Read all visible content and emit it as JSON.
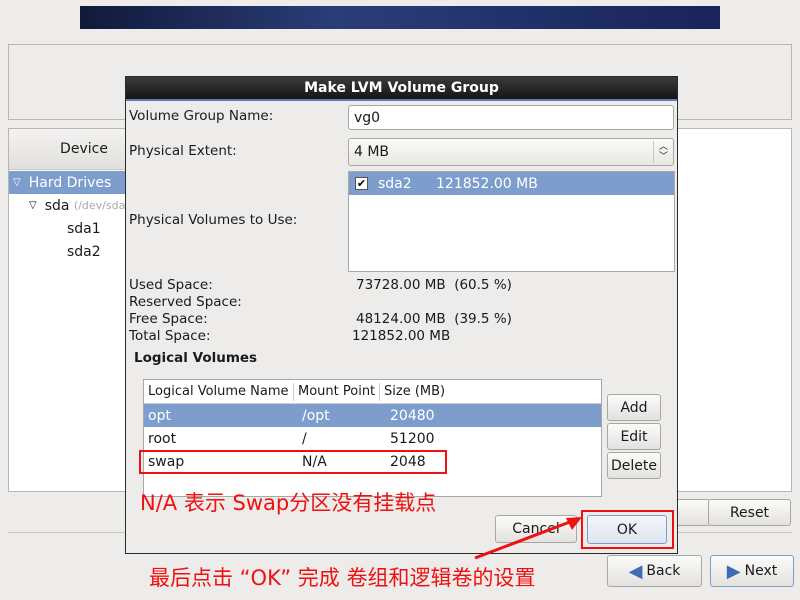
{
  "background": {
    "device_column": "Device",
    "tree": [
      {
        "label": "Hard Drives"
      },
      {
        "label": "sda",
        "path": "(/dev/sda"
      },
      {
        "label": "sda1"
      },
      {
        "label": "sda2"
      }
    ],
    "reset_label": "Reset",
    "back_label": "Back",
    "next_label": "Next"
  },
  "dialog": {
    "title": "Make LVM Volume Group",
    "vg_name_label": "Volume Group Name:",
    "vg_name_value": "vg0",
    "pe_label": "Physical Extent:",
    "pe_value": "4 MB",
    "pv_label": "Physical Volumes to Use:",
    "pv_items": [
      {
        "name": "sda2",
        "size": "121852.00 MB",
        "checked": true
      }
    ],
    "used_label": "Used Space:",
    "used_value": "73728.00 MB  (60.5 %)",
    "reserved_label": "Reserved Space:",
    "free_label": "Free Space:",
    "free_value": "48124.00 MB  (39.5 %)",
    "total_label": "Total Space:",
    "total_value": "121852.00 MB",
    "lv_heading": "Logical Volumes",
    "lv_columns": [
      "Logical Volume Name",
      "Mount Point",
      "Size (MB)"
    ],
    "lv_rows": [
      {
        "name": "opt",
        "mount": "/opt",
        "size": "20480"
      },
      {
        "name": "root",
        "mount": "/",
        "size": "51200"
      },
      {
        "name": "swap",
        "mount": "N/A",
        "size": "2048"
      }
    ],
    "add_label": "Add",
    "edit_label": "Edit",
    "delete_label": "Delete",
    "cancel_label": "Cancel",
    "ok_label": "OK"
  },
  "annotations": {
    "na_note": "N/A 表示 Swap分区没有挂载点",
    "ok_note": "最后点击 “OK” 完成 卷组和逻辑卷的设置",
    "color": "#f01010"
  }
}
